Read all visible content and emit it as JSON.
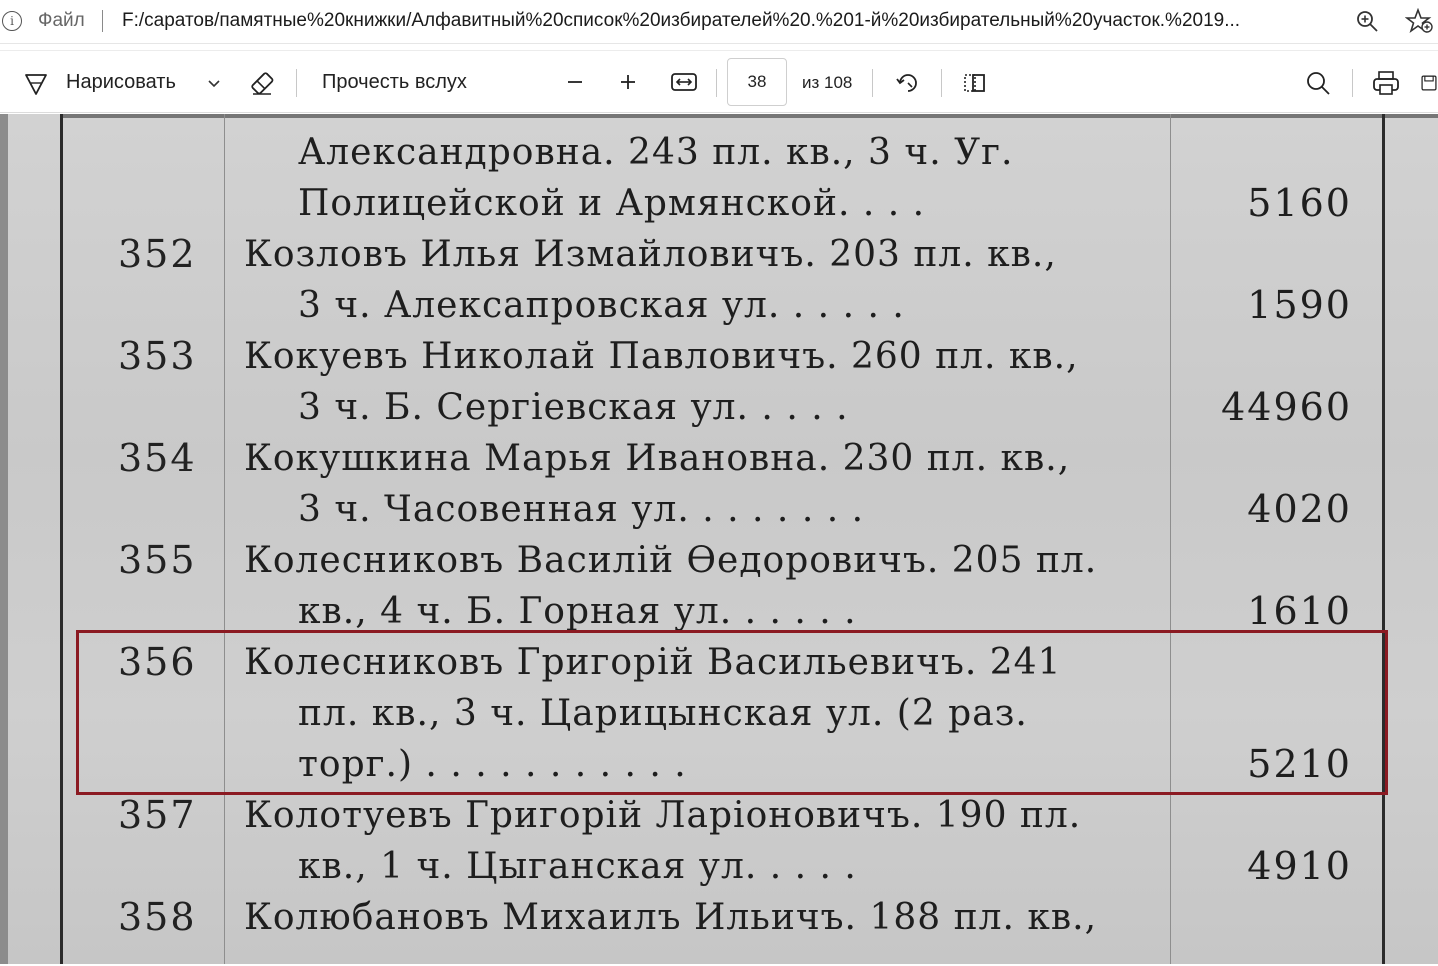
{
  "addressbar": {
    "file_label": "Файл",
    "url": "F:/саратов/памятные%20книжки/Алфавитный%20список%20избирателей%20.%201-й%20избирательный%20участок.%2019..."
  },
  "toolbar": {
    "draw_label": "Нарисовать",
    "read_aloud_label": "Прочесть вслух",
    "page_number": "38",
    "page_of": "из 108"
  },
  "document": {
    "lines": [
      {
        "num": "",
        "text": "Александровна.  243 пл. кв., 3 ч.  Уг.",
        "amount": ""
      },
      {
        "num": "",
        "text": "Полицейской  и  Армянской.    .    .    .",
        "amount": "5160"
      },
      {
        "num": "352",
        "text": "Козловъ  Илья  Измайловичъ. 203  пл. кв.,",
        "amount": ""
      },
      {
        "num": "",
        "text": "3 ч.  Алексапровская  ул. .   .   .   .   .",
        "amount": "1590"
      },
      {
        "num": "353",
        "text": "Кокуевъ  Николай  Павловичъ. 260  пл. кв.,",
        "amount": ""
      },
      {
        "num": "",
        "text": "3 ч.  Б.  Сергіевская  ул.   .   .   .   .",
        "amount": "44960"
      },
      {
        "num": "354",
        "text": "Кокушкина  Марья  Ивановна. 230  пл. кв.,",
        "amount": ""
      },
      {
        "num": "",
        "text": "3 ч. Часовенная  ул. .  .   .   .   .   .   .",
        "amount": "4020"
      },
      {
        "num": "355",
        "text": "Колесниковъ  Василій  Өедоровичъ.  205  пл.",
        "amount": ""
      },
      {
        "num": "",
        "text": "кв., 4 ч.  Б.  Горная  ул.  .   .   .   .   .",
        "amount": "1610"
      },
      {
        "num": "356",
        "text": "Колесниковъ   Григорій   Васильевичъ.  241",
        "amount": ""
      },
      {
        "num": "",
        "text": "пл.  кв.,  3  ч.  Царицынская   ул. (2  раз.",
        "amount": ""
      },
      {
        "num": "",
        "text": "торг.) .   .   .   .   .   .   .   .   .   .   .",
        "amount": "5210"
      },
      {
        "num": "357",
        "text": "Колотуевъ  Григорій  Ларіоновичъ.  190  пл.",
        "amount": ""
      },
      {
        "num": "",
        "text": "кв.,  1  ч.  Цыганская  ул.   .   .   .   .",
        "amount": "4910"
      },
      {
        "num": "358",
        "text": "Колюбановъ  Михаилъ  Ильичъ. 188  пл. кв.,",
        "amount": ""
      }
    ]
  }
}
